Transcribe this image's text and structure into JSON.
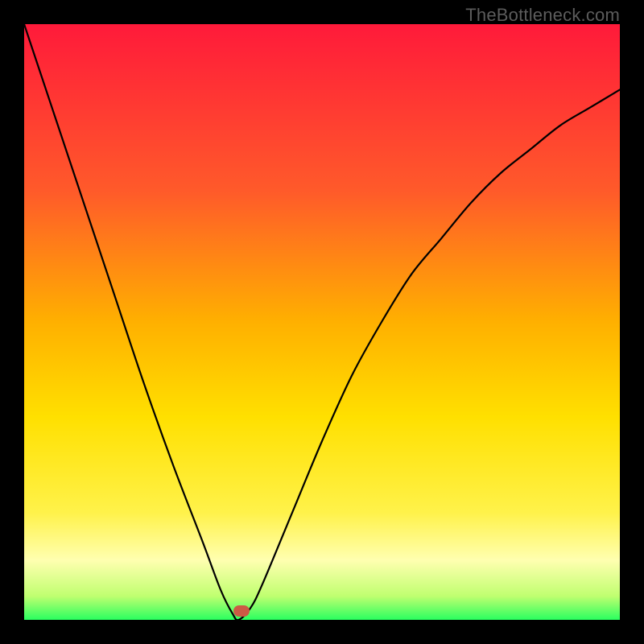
{
  "attribution": "TheBottleneck.com",
  "chart_data": {
    "type": "line",
    "title": "",
    "xlabel": "",
    "ylabel": "",
    "xlim": [
      0,
      100
    ],
    "ylim": [
      0,
      100
    ],
    "series": [
      {
        "name": "curve",
        "x": [
          0,
          5,
          10,
          15,
          20,
          25,
          30,
          33,
          35,
          36,
          38,
          40,
          45,
          50,
          55,
          60,
          65,
          70,
          75,
          80,
          85,
          90,
          95,
          100
        ],
        "values": [
          100,
          85,
          70,
          55,
          40,
          26,
          13,
          5,
          1,
          0,
          2,
          6,
          18,
          30,
          41,
          50,
          58,
          64,
          70,
          75,
          79,
          83,
          86,
          89
        ]
      }
    ],
    "marker": {
      "x": 36.5,
      "y": 1.5
    },
    "colors": {
      "curve": "#000000",
      "marker": "#cc5a45",
      "gradient_top": "#ff1a3a",
      "gradient_bottom": "#2aff60"
    }
  }
}
